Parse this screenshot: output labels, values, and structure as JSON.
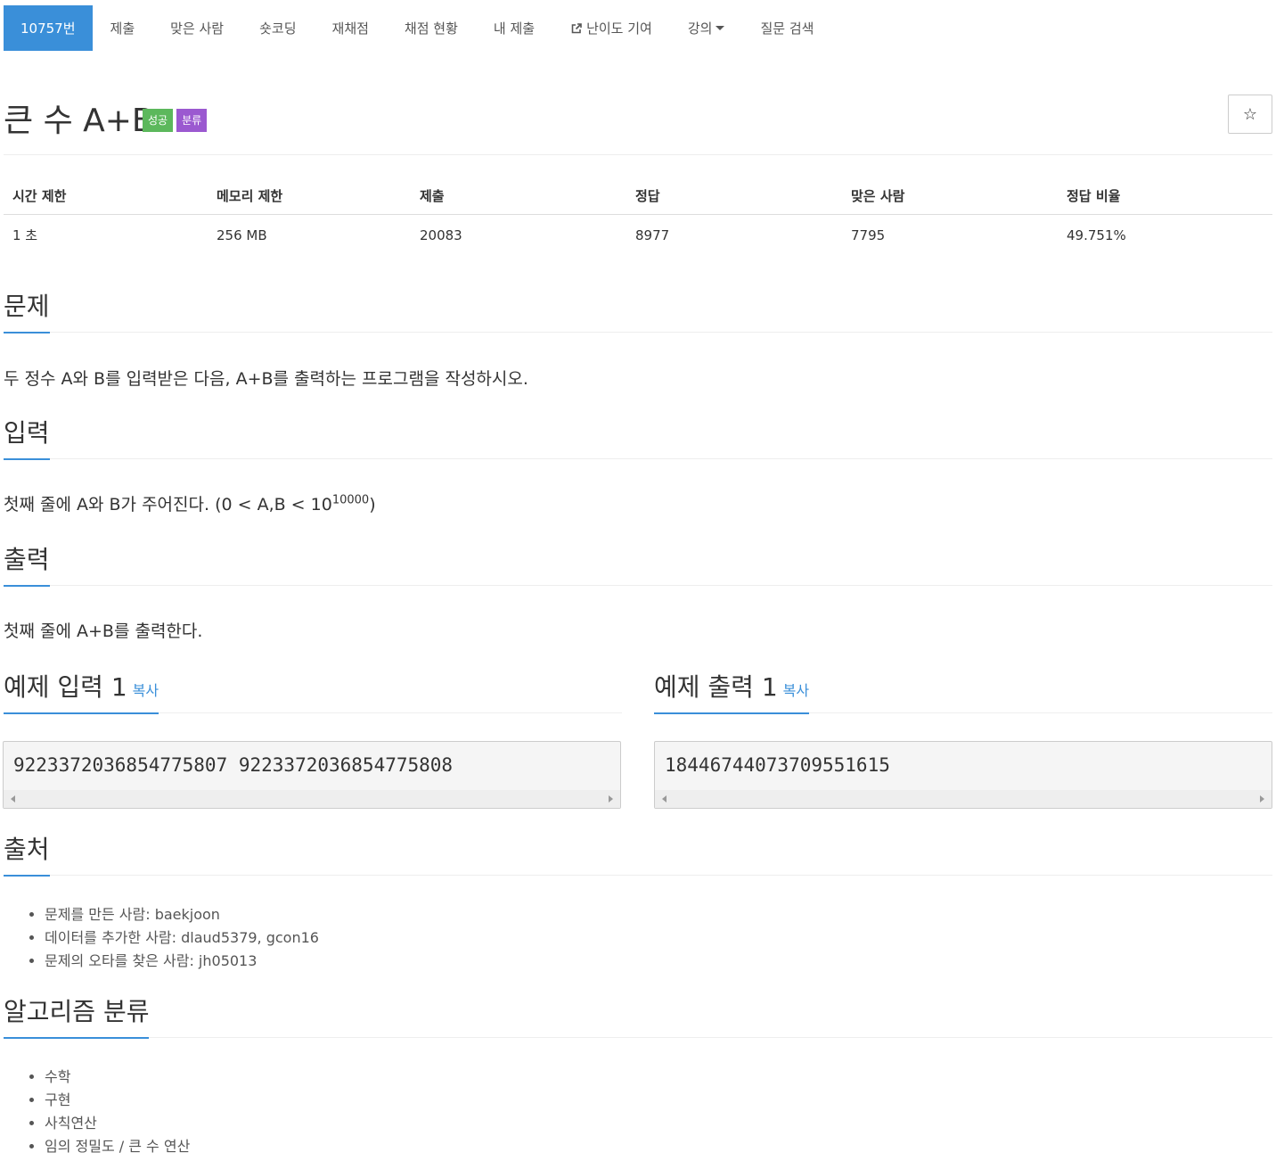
{
  "nav": {
    "items": [
      {
        "label": "10757번",
        "active": true
      },
      {
        "label": "제출"
      },
      {
        "label": "맞은 사람"
      },
      {
        "label": "숏코딩"
      },
      {
        "label": "재채점"
      },
      {
        "label": "채점 현황"
      },
      {
        "label": "내 제출"
      },
      {
        "label": "난이도 기여",
        "icon": "external-link-icon"
      },
      {
        "label": "강의",
        "icon": "caret-down-icon"
      },
      {
        "label": "질문 검색"
      }
    ]
  },
  "problem": {
    "title": "큰 수 A+B",
    "badges": [
      "성공",
      "분류"
    ],
    "badge_colors": [
      "#5cb85c",
      "#9b59d0"
    ],
    "star_icon": "☆"
  },
  "info_table": {
    "headers": [
      "시간 제한",
      "메모리 제한",
      "제출",
      "정답",
      "맞은 사람",
      "정답 비율"
    ],
    "values": [
      "1 초",
      "256 MB",
      "20083",
      "8977",
      "7795",
      "49.751%"
    ]
  },
  "sections": {
    "description": {
      "title": "문제",
      "text": "두 정수 A와 B를 입력받은 다음, A+B를 출력하는 프로그램을 작성하시오."
    },
    "input": {
      "title": "입력",
      "text_before": "첫째 줄에 A와 B가 주어진다. (0 < A,B < 10",
      "sup": "10000",
      "text_after": ")"
    },
    "output": {
      "title": "출력",
      "text": "첫째 줄에 A+B를 출력한다."
    },
    "sample_input": {
      "title": "예제 입력 1",
      "copy": "복사",
      "value": "9223372036854775807 9223372036854775808"
    },
    "sample_output": {
      "title": "예제 출력 1",
      "copy": "복사",
      "value": "18446744073709551615"
    },
    "source": {
      "title": "출처",
      "items": [
        "문제를 만든 사람: baekjoon",
        "데이터를 추가한 사람: dlaud5379, gcon16",
        "문제의 오타를 찾은 사람: jh05013"
      ]
    },
    "algorithm": {
      "title": "알고리즘 분류",
      "items": [
        "수학",
        "구현",
        "사칙연산",
        "임의 정밀도 / 큰 수 연산"
      ]
    }
  },
  "colors": {
    "accent": "#3a8fd9"
  }
}
